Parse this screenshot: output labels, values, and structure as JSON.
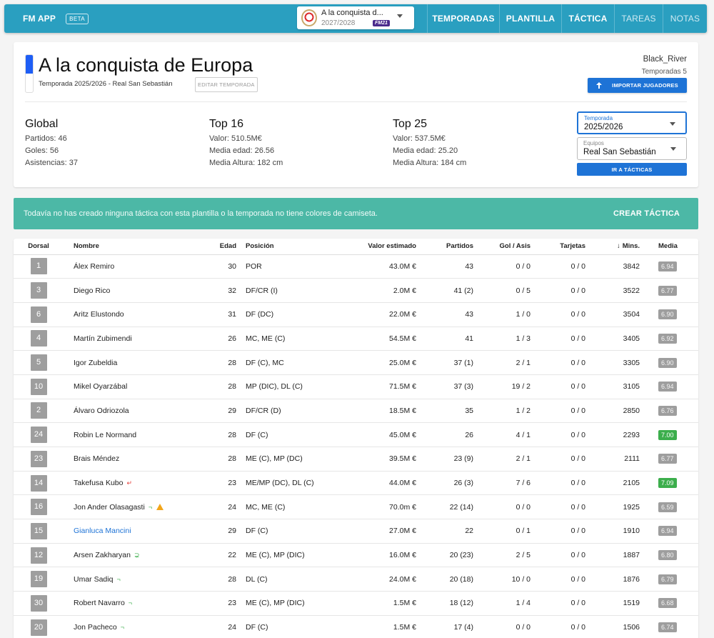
{
  "topbar": {
    "brand": "FM APP",
    "beta": "BETA",
    "save": {
      "name": "A la conquista d...",
      "season": "2027/2028",
      "badge": "FM21"
    },
    "nav": [
      {
        "label": "TEMPORADAS",
        "width": 101,
        "dim": false
      },
      {
        "label": "PLANTILLA",
        "width": 87,
        "dim": false
      },
      {
        "label": "TÁCTICA",
        "width": 74,
        "dim": false
      },
      {
        "label": "TAREAS",
        "width": 68,
        "dim": true
      },
      {
        "label": "NOTAS",
        "width": 62,
        "dim": true
      }
    ]
  },
  "header": {
    "title": "A la conquista de Europa",
    "subtitle": "Temporada 2025/2026 - Real San Sebastián",
    "edit_label": "EDITAR TEMPORADA",
    "user": "Black_River",
    "seasons": "Temporadas 5",
    "import_label": "IMPORTAR JUGADORES",
    "accent_color": "#1e5ef5"
  },
  "stats": {
    "global": {
      "title": "Global",
      "lines": [
        "Partidos: 46",
        "Goles: 56",
        "Asistencias: 37"
      ]
    },
    "top16": {
      "title": "Top 16",
      "lines": [
        "Valor: 510.5M€",
        "Media edad: 26.56",
        "Media Altura: 182 cm"
      ]
    },
    "top25": {
      "title": "Top 25",
      "lines": [
        "Valor: 537.5M€",
        "Media edad: 25.20",
        "Media Altura: 184 cm"
      ]
    }
  },
  "filters": {
    "season": {
      "label": "Temporada",
      "value": "2025/2026"
    },
    "team": {
      "label": "Equipos",
      "value": "Real San Sebastián"
    },
    "tactics_label": "IR A TÁCTICAS"
  },
  "banner": {
    "text": "Todavía no has creado ninguna táctica con esta plantilla o la temporada no tiene colores de camiseta.",
    "action": "CREAR TÁCTICA",
    "color": "#4cb8a6"
  },
  "table": {
    "columns": [
      "Dorsal",
      "Nombre",
      "Edad",
      "Posición",
      "Valor estimado",
      "Partidos",
      "Gol / Asis",
      "Tarjetas",
      "Mins.",
      "Media"
    ],
    "sort_icon": "↓",
    "rows": [
      {
        "dorsal": "1",
        "name": "Álex Remiro",
        "age": "30",
        "pos": "POR",
        "value": "43.0M €",
        "matches": "43",
        "ga": "0 / 0",
        "cards": "0 / 0",
        "mins": "3842",
        "rating": "6.94",
        "good": false,
        "mark": "",
        "link": false,
        "warn": false
      },
      {
        "dorsal": "3",
        "name": "Diego Rico",
        "age": "32",
        "pos": "DF/CR (I)",
        "value": "2.0M €",
        "matches": "41 (2)",
        "ga": "0 / 5",
        "cards": "0 / 0",
        "mins": "3522",
        "rating": "6.77",
        "good": false,
        "mark": "",
        "link": false,
        "warn": false
      },
      {
        "dorsal": "6",
        "name": "Aritz Elustondo",
        "age": "31",
        "pos": "DF (DC)",
        "value": "22.0M €",
        "matches": "43",
        "ga": "1 / 0",
        "cards": "0 / 0",
        "mins": "3504",
        "rating": "6.90",
        "good": false,
        "mark": "",
        "link": false,
        "warn": false
      },
      {
        "dorsal": "4",
        "name": "Martín Zubimendi",
        "age": "26",
        "pos": "MC, ME (C)",
        "value": "54.5M €",
        "matches": "41",
        "ga": "1 / 3",
        "cards": "0 / 0",
        "mins": "3405",
        "rating": "6.92",
        "good": false,
        "mark": "",
        "link": false,
        "warn": false
      },
      {
        "dorsal": "5",
        "name": "Igor Zubeldia",
        "age": "28",
        "pos": "DF (C), MC",
        "value": "25.0M €",
        "matches": "37 (1)",
        "ga": "2 / 1",
        "cards": "0 / 0",
        "mins": "3305",
        "rating": "6.90",
        "good": false,
        "mark": "",
        "link": false,
        "warn": false
      },
      {
        "dorsal": "10",
        "name": "Mikel Oyarzábal",
        "age": "28",
        "pos": "MP (DIC), DL (C)",
        "value": "71.5M €",
        "matches": "37 (3)",
        "ga": "19 / 2",
        "cards": "0 / 0",
        "mins": "3105",
        "rating": "6.94",
        "good": false,
        "mark": "",
        "link": false,
        "warn": false
      },
      {
        "dorsal": "2",
        "name": "Álvaro Odriozola",
        "age": "29",
        "pos": "DF/CR (D)",
        "value": "18.5M €",
        "matches": "35",
        "ga": "1 / 2",
        "cards": "0 / 0",
        "mins": "2850",
        "rating": "6.76",
        "good": false,
        "mark": "",
        "link": false,
        "warn": false
      },
      {
        "dorsal": "24",
        "name": "Robin Le Normand",
        "age": "28",
        "pos": "DF (C)",
        "value": "45.0M €",
        "matches": "26",
        "ga": "4 / 1",
        "cards": "0 / 0",
        "mins": "2293",
        "rating": "7.00",
        "good": true,
        "mark": "",
        "link": false,
        "warn": false
      },
      {
        "dorsal": "23",
        "name": "Brais Méndez",
        "age": "28",
        "pos": "ME (C), MP (DC)",
        "value": "39.5M €",
        "matches": "23 (9)",
        "ga": "2 / 1",
        "cards": "0 / 0",
        "mins": "2111",
        "rating": "6.77",
        "good": false,
        "mark": "",
        "link": false,
        "warn": false
      },
      {
        "dorsal": "14",
        "name": "Takefusa Kubo",
        "age": "23",
        "pos": "ME/MP (DC), DL (C)",
        "value": "44.0M €",
        "matches": "26 (3)",
        "ga": "7 / 6",
        "cards": "0 / 0",
        "mins": "2105",
        "rating": "7.09",
        "good": true,
        "mark": "red",
        "link": false,
        "warn": false
      },
      {
        "dorsal": "16",
        "name": "Jon Ander Olasagasti",
        "age": "24",
        "pos": "MC, ME (C)",
        "value": "70.0m €",
        "matches": "22 (14)",
        "ga": "0 / 0",
        "cards": "0 / 0",
        "mins": "1925",
        "rating": "6.59",
        "good": false,
        "mark": "green",
        "link": false,
        "warn": true
      },
      {
        "dorsal": "15",
        "name": "Gianluca Mancini",
        "age": "29",
        "pos": "DF (C)",
        "value": "27.0M €",
        "matches": "22",
        "ga": "0 / 1",
        "cards": "0 / 0",
        "mins": "1910",
        "rating": "6.94",
        "good": false,
        "mark": "",
        "link": true,
        "warn": false
      },
      {
        "dorsal": "12",
        "name": "Arsen Zakharyan",
        "age": "22",
        "pos": "ME (C), MP (DIC)",
        "value": "16.0M €",
        "matches": "20 (23)",
        "ga": "2 / 5",
        "cards": "0 / 0",
        "mins": "1887",
        "rating": "6.80",
        "good": false,
        "mark": "green2",
        "link": false,
        "warn": false
      },
      {
        "dorsal": "19",
        "name": "Umar Sadiq",
        "age": "28",
        "pos": "DL (C)",
        "value": "24.0M €",
        "matches": "20 (18)",
        "ga": "10 / 0",
        "cards": "0 / 0",
        "mins": "1876",
        "rating": "6.79",
        "good": false,
        "mark": "green",
        "link": false,
        "warn": false
      },
      {
        "dorsal": "30",
        "name": "Robert Navarro",
        "age": "23",
        "pos": "ME (C), MP (DIC)",
        "value": "1.5M €",
        "matches": "18 (12)",
        "ga": "1 / 4",
        "cards": "0 / 0",
        "mins": "1519",
        "rating": "6.68",
        "good": false,
        "mark": "green",
        "link": false,
        "warn": false
      },
      {
        "dorsal": "20",
        "name": "Jon Pacheco",
        "age": "24",
        "pos": "DF (C)",
        "value": "1.5M €",
        "matches": "17 (4)",
        "ga": "0 / 0",
        "cards": "0 / 0",
        "mins": "1506",
        "rating": "6.74",
        "good": false,
        "mark": "green",
        "link": false,
        "warn": false
      }
    ]
  }
}
